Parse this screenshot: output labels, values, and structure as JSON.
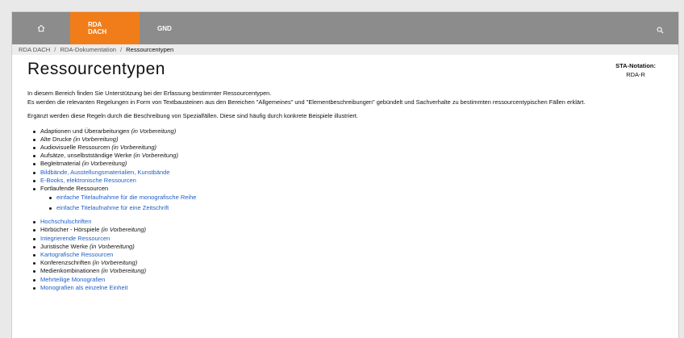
{
  "nav": {
    "home_icon": "home-icon",
    "tabs": [
      {
        "label": "RDA DACH",
        "active": true
      },
      {
        "label": "GND",
        "active": false
      }
    ],
    "search_icon": "search-icon",
    "active_color": "#f07d1a",
    "bar_color": "#8c8c8c"
  },
  "breadcrumb": {
    "items": [
      "RDA DACH",
      "RDA-Dokumentation",
      "Ressourcentypen"
    ],
    "separator": "/"
  },
  "page": {
    "title": "Ressourcentypen",
    "sta_label": "STA-Notation:",
    "sta_value": "RDA-R",
    "intro_line1": "In diesem Bereich finden Sie Unterstützung bei der Erfassung bestimmter Ressourcentypen.",
    "intro_line2": "Es werden die relevanten Regelungen in Form von Textbausteinen aus den Bereichen \"Allgemeines\" und \"Elementbeschreibungen\" gebündelt und Sachverhalte zu bestimmten ressourcentypischen Fällen erklärt.",
    "para2": "Ergänzt werden diese Regeln durch die Beschreibung von Spezialfällen. Diese sind häufig durch konkrete Beispiele illustriert.",
    "link_color": "#1e5fc4"
  },
  "list1": [
    {
      "text": "Adaptionen und Überarbeitungen",
      "note": "(in Vorbereitung)",
      "link": false
    },
    {
      "text": "Alte Drucke",
      "note": "(in Vorbereitung)",
      "link": false
    },
    {
      "text": "Audiovisuelle Ressourcen",
      "note": "(in Vorbereitung)",
      "link": false
    },
    {
      "text": "Aufsätze, unselbstständige Werke",
      "note": "(in Vorbereitung)",
      "link": false
    },
    {
      "text": "Begleitmaterial",
      "note": "(in Vorbereitung)",
      "link": false
    },
    {
      "text": "Bildbände, Ausstellungsmaterialien, Kunstbände",
      "note": "",
      "link": true
    },
    {
      "text": "E-Books, elektronische Ressourcen",
      "note": "",
      "link": true
    },
    {
      "text": "Fortlaufende Ressourcen",
      "note": "",
      "link": false
    }
  ],
  "sublist": [
    {
      "text": "einfache Titelaufnahme für die monografische Reihe",
      "link": true
    },
    {
      "text": "einfache Titelaufnahme für eine Zeitschrift",
      "link": true
    }
  ],
  "list2": [
    {
      "text": "Hochschulschriften",
      "note": "",
      "link": true
    },
    {
      "text": "Hörbücher - Hörspiele",
      "note": "(in Vorbereitung)",
      "link": false
    },
    {
      "text": "Integrierende Ressourcen",
      "note": "",
      "link": true
    },
    {
      "text": "Juristische Werke",
      "note": "(in Vorbereitung)",
      "link": false
    },
    {
      "text": "Kartografische Ressourcen",
      "note": "",
      "link": true
    },
    {
      "text": "Konferenzschriften",
      "note": "(in Vorbereitung)",
      "link": false
    },
    {
      "text": "Medienkombinationen",
      "note": "(in Vorbereitung)",
      "link": false
    },
    {
      "text": "Mehrteilige Monografien",
      "note": "",
      "link": true
    },
    {
      "text": "Monografien als einzelne Einheit",
      "note": "",
      "link": true
    }
  ]
}
